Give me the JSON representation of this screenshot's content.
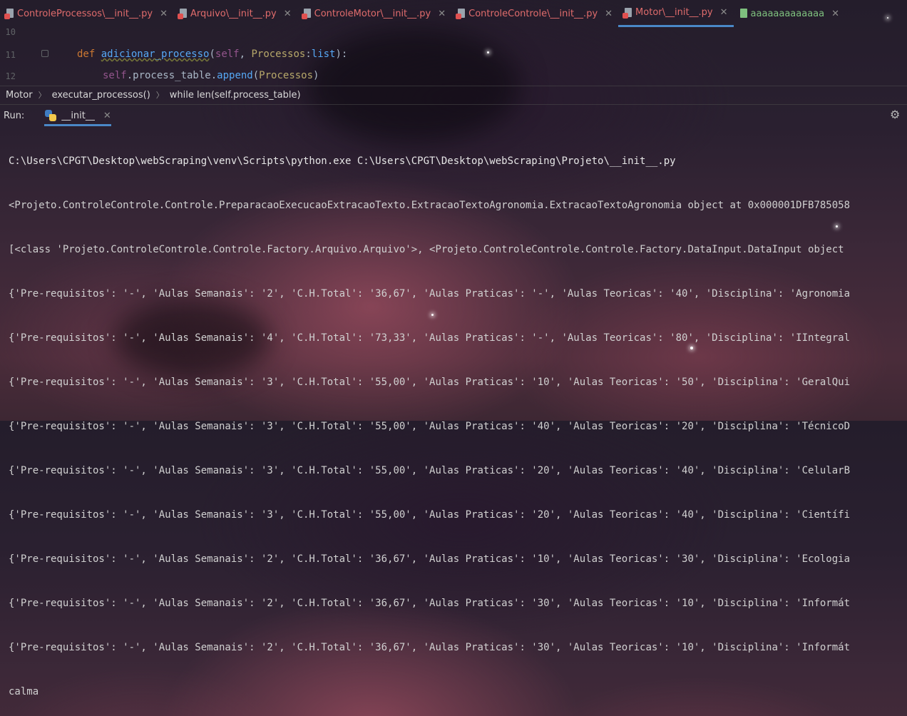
{
  "tabs": [
    {
      "label": "ControleProcessos\\__init__.py",
      "type": "python-file-icon"
    },
    {
      "label": "Arquivo\\__init__.py",
      "type": "python-file-icon"
    },
    {
      "label": "ControleMotor\\__init__.py",
      "type": "python-file-icon"
    },
    {
      "label": "ControleControle\\__init__.py",
      "type": "python-file-icon"
    },
    {
      "label": "Motor\\__init__.py",
      "type": "python-file-icon",
      "active": true
    },
    {
      "label": "aaaaaaaaaaaaa",
      "type": "text-file-icon"
    }
  ],
  "editor": {
    "line_numbers": [
      "10",
      "11",
      "12"
    ],
    "line11": {
      "kw": "def",
      "fn": "adicionar_processo",
      "self": "self",
      "param": "Processos",
      "type": "list"
    },
    "line12": {
      "self": "self",
      "attr": ".process_table.",
      "method": "append",
      "arg": "Processos"
    }
  },
  "breadcrumb": [
    "Motor",
    "executar_processos()",
    "while len(self.process_table)"
  ],
  "run": {
    "label": "Run:",
    "tab_label": "__init__"
  },
  "console": {
    "lines": [
      "C:\\Users\\CPGT\\Desktop\\webScraping\\venv\\Scripts\\python.exe C:\\Users\\CPGT\\Desktop\\webScraping\\Projeto\\__init__.py",
      "<Projeto.ControleControle.Controle.PreparacaoExecucaoExtracaoTexto.ExtracaoTextoAgronomia.ExtracaoTextoAgronomia object at 0x000001DFB785058",
      "[<class 'Projeto.ControleControle.Controle.Factory.Arquivo.Arquivo'>, <Projeto.ControleControle.Controle.Factory.DataInput.DataInput object",
      "{'Pre-requisitos': '-', 'Aulas Semanais': '2', 'C.H.Total': '36,67', 'Aulas Praticas': '-', 'Aulas Teoricas': '40', 'Disciplina': 'Agronomia",
      "{'Pre-requisitos': '-', 'Aulas Semanais': '4', 'C.H.Total': '73,33', 'Aulas Praticas': '-', 'Aulas Teoricas': '80', 'Disciplina': 'IIntegral",
      "{'Pre-requisitos': '-', 'Aulas Semanais': '3', 'C.H.Total': '55,00', 'Aulas Praticas': '10', 'Aulas Teoricas': '50', 'Disciplina': 'GeralQui",
      "{'Pre-requisitos': '-', 'Aulas Semanais': '3', 'C.H.Total': '55,00', 'Aulas Praticas': '40', 'Aulas Teoricas': '20', 'Disciplina': 'TécnicoD",
      "{'Pre-requisitos': '-', 'Aulas Semanais': '3', 'C.H.Total': '55,00', 'Aulas Praticas': '20', 'Aulas Teoricas': '40', 'Disciplina': 'CelularB",
      "{'Pre-requisitos': '-', 'Aulas Semanais': '3', 'C.H.Total': '55,00', 'Aulas Praticas': '20', 'Aulas Teoricas': '40', 'Disciplina': 'Científi",
      "{'Pre-requisitos': '-', 'Aulas Semanais': '2', 'C.H.Total': '36,67', 'Aulas Praticas': '10', 'Aulas Teoricas': '30', 'Disciplina': 'Ecologia",
      "{'Pre-requisitos': '-', 'Aulas Semanais': '2', 'C.H.Total': '36,67', 'Aulas Praticas': '30', 'Aulas Teoricas': '10', 'Disciplina': 'Informát",
      "{'Pre-requisitos': '-', 'Aulas Semanais': '2', 'C.H.Total': '36,67', 'Aulas Praticas': '30', 'Aulas Teoricas': '10', 'Disciplina': 'Informát",
      "calma"
    ]
  },
  "colors": {
    "tab_text": "#e06c6c",
    "active_tab_underline": "#4a88c7",
    "console_text": "#d0d0d0",
    "keyword": "#cc7832",
    "function": "#56a8f5",
    "self": "#94558d",
    "param": "#b7a86a"
  }
}
